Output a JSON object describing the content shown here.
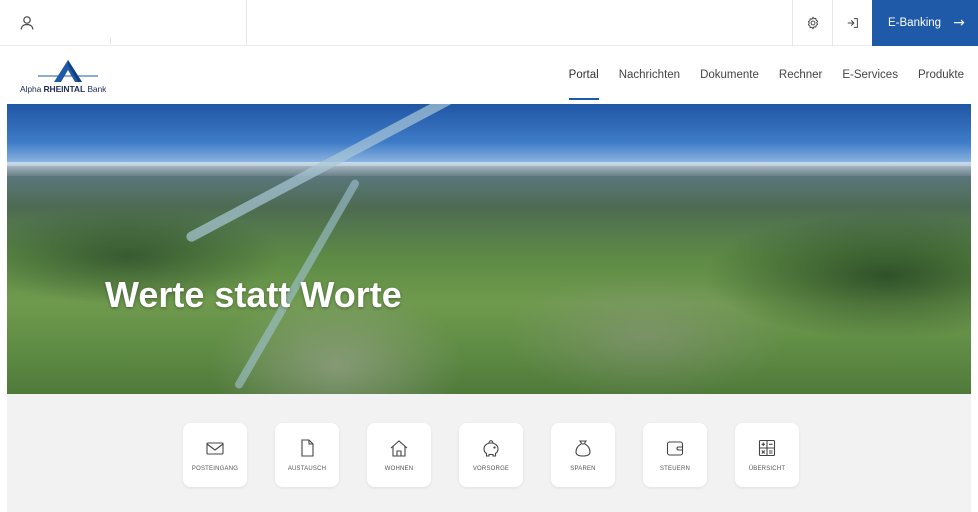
{
  "topbar": {
    "user_icon": "user-icon",
    "gear_icon": "gear-icon",
    "login_icon": "login-icon",
    "ebanking_label": "E-Banking",
    "ebanking_arrow": "→"
  },
  "brand": {
    "logo_text_light": "Alpha ",
    "logo_text_bold": "RHEINTAL",
    "logo_text_end": " Bank",
    "accent": "#1e5aa8"
  },
  "nav": {
    "items": [
      {
        "label": "Portal",
        "active": true
      },
      {
        "label": "Nachrichten"
      },
      {
        "label": "Dokumente"
      },
      {
        "label": "Rechner"
      },
      {
        "label": "E-Services"
      },
      {
        "label": "Produkte"
      }
    ]
  },
  "hero": {
    "title": "Werte statt Worte"
  },
  "quicklinks": [
    {
      "label": "POSTEINGANG",
      "icon": "envelope-icon"
    },
    {
      "label": "AUSTAUSCH",
      "icon": "document-icon"
    },
    {
      "label": "WOHNEN",
      "icon": "house-icon"
    },
    {
      "label": "VORSORGE",
      "icon": "piggy-bank-icon"
    },
    {
      "label": "SPAREN",
      "icon": "money-bag-icon"
    },
    {
      "label": "STEUERN",
      "icon": "wallet-icon"
    },
    {
      "label": "ÜBERSICHT",
      "icon": "calculator-icon"
    }
  ]
}
